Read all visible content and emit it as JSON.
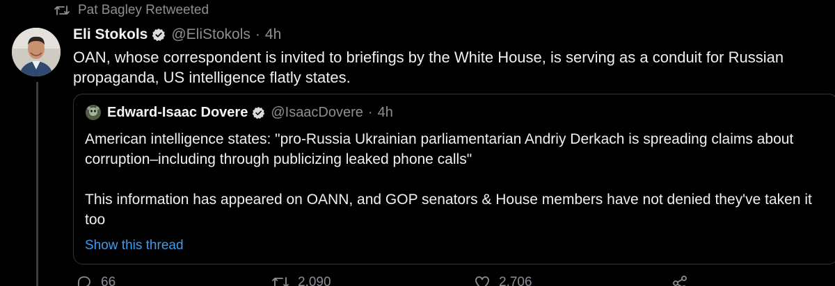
{
  "retweet_banner": {
    "icon": "retweet-icon",
    "label": "Pat Bagley Retweeted"
  },
  "tweet": {
    "author_name": "Eli Stokols",
    "author_handle": "@EliStokols",
    "separator": "·",
    "time": "4h",
    "verified_icon": "verified-badge-icon",
    "text": "OAN, whose correspondent is invited to briefings by the White House, is serving as a conduit for Russian propaganda, US intelligence flatly states."
  },
  "quoted_tweet": {
    "author_name": "Edward-Isaac Dovere",
    "author_handle": "@IsaacDovere",
    "separator": "·",
    "time": "4h",
    "verified_icon": "verified-badge-icon",
    "paragraphs": [
      "American intelligence states: \"pro-Russia Ukrainian parliamentarian Andriy Derkach is spreading claims about corruption–including through publicizing leaked phone calls\"",
      "This information has appeared on OANN, and GOP senators & House members have not denied they've taken it too"
    ],
    "show_thread_label": "Show this thread"
  },
  "actions": {
    "reply_count": "66",
    "retweet_count": "2,090",
    "like_count": "2,706",
    "icons": [
      "reply-icon",
      "retweet-icon",
      "like-icon",
      "share-icon"
    ]
  },
  "colors": {
    "background": "#000000",
    "text": "#eef0f1",
    "muted": "#8b8f94",
    "link": "#3d9bf0",
    "border": "#34373b"
  }
}
